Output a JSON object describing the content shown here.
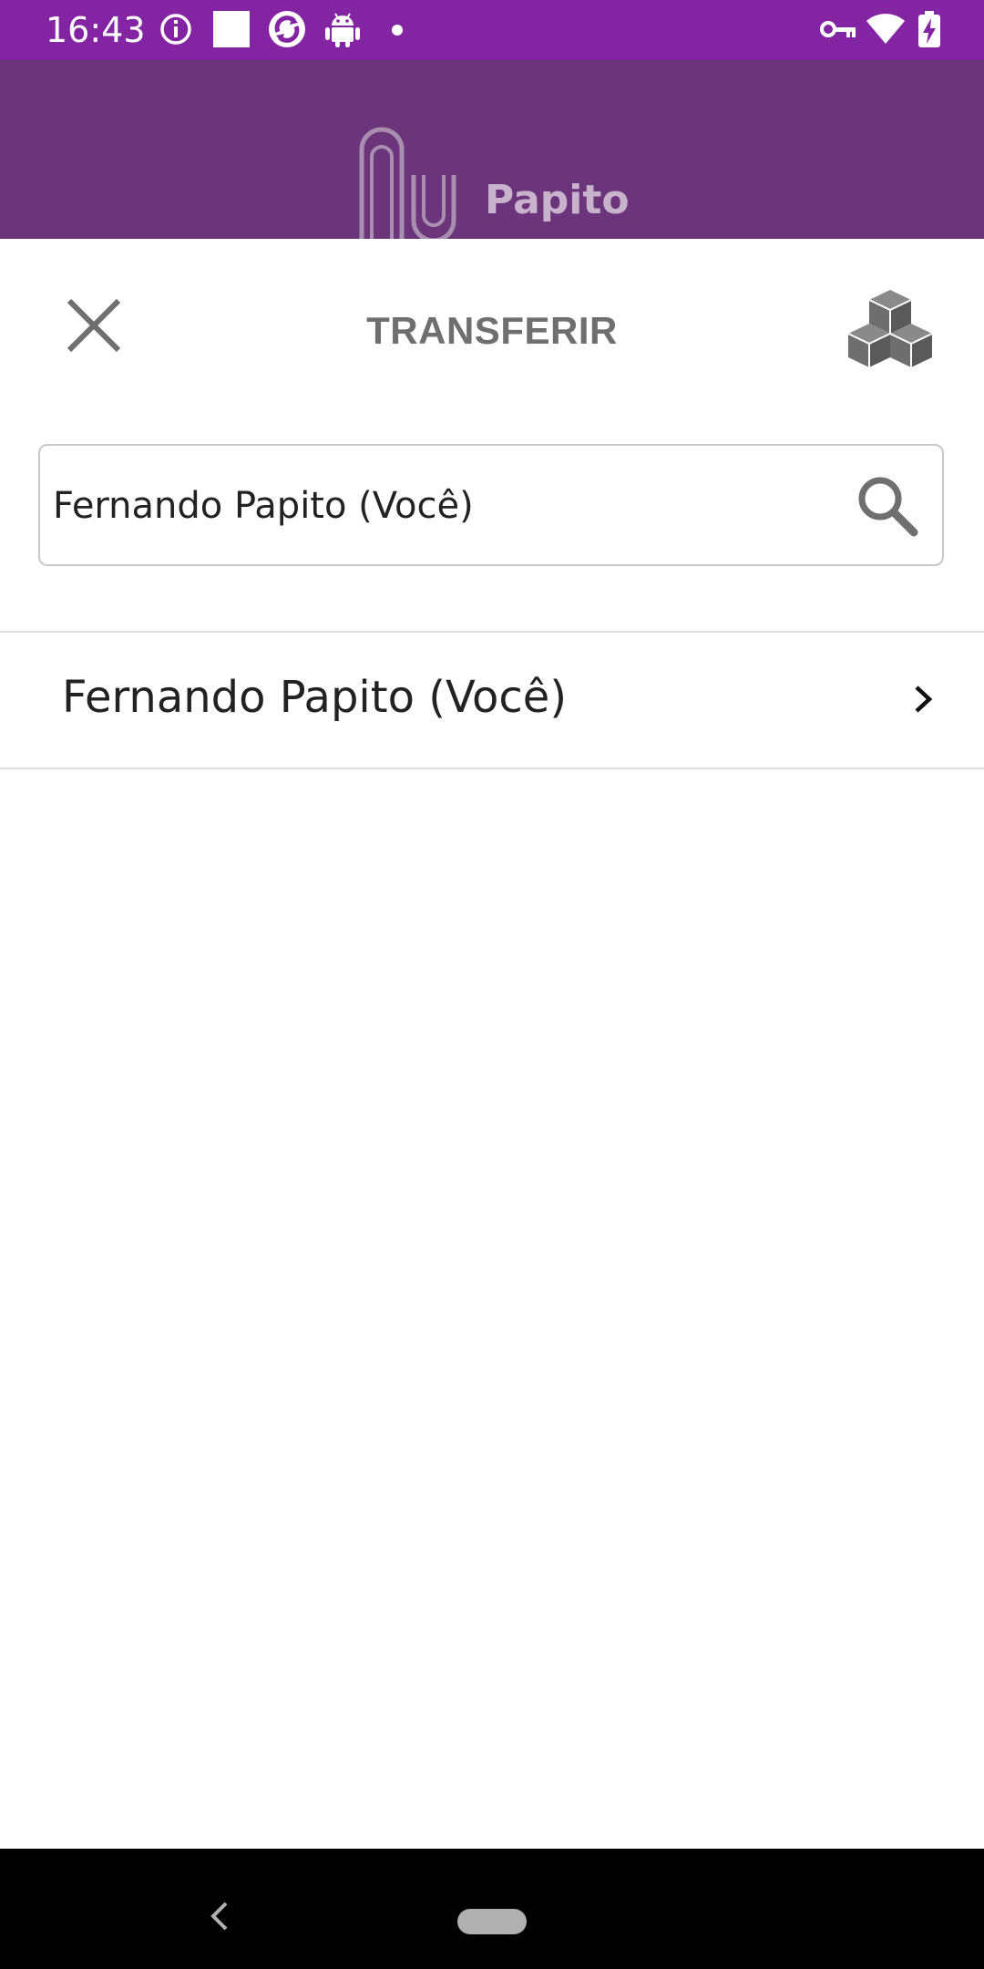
{
  "status_bar": {
    "time": "16:43",
    "bg_color": "#8325a3",
    "left_icons": [
      "info-icon",
      "square-icon",
      "sync-app-icon",
      "android-icon",
      "dot-icon"
    ],
    "right_icons": [
      "vpn-key-icon",
      "wifi-icon",
      "battery-charging-icon"
    ]
  },
  "header": {
    "brand_name": "Papito",
    "bg_color": "#6b347b",
    "logo_icon": "nu-logo-icon"
  },
  "toolbar": {
    "title": "TRANSFERIR",
    "close_icon": "close-icon",
    "action_icon": "cubes-icon"
  },
  "search": {
    "value": "Fernando Papito (Você)",
    "icon": "search-icon"
  },
  "results": [
    {
      "label": "Fernando Papito (Você)",
      "icon": "chevron-right-icon"
    }
  ],
  "navigation_bar": {
    "back_icon": "back-icon",
    "home_icon": "home-pill-icon"
  }
}
